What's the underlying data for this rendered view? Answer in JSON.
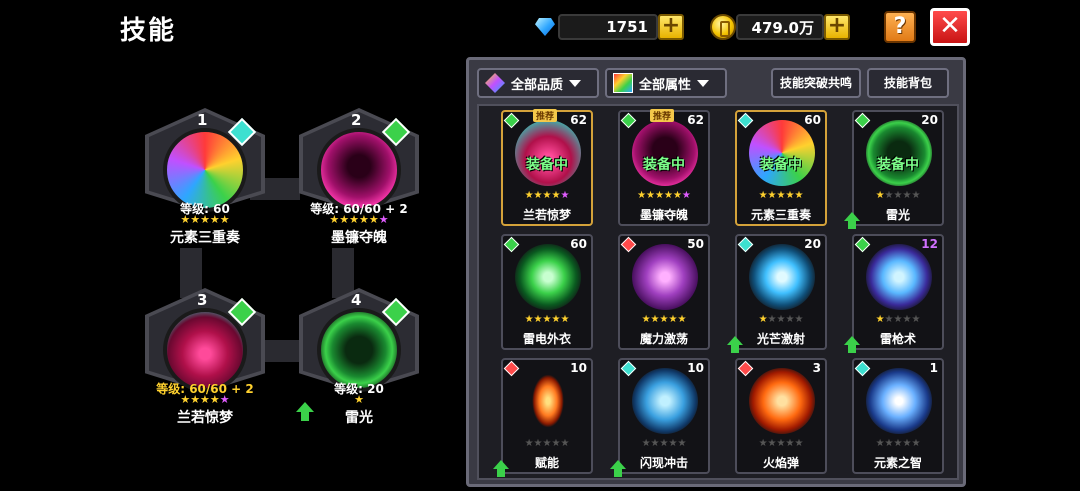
{
  "header": {
    "title": "技能"
  },
  "currency": {
    "gems": "1751",
    "gold": "479.0万",
    "gem_icon": "diamond-icon",
    "gold_icon": "coin-icon",
    "plus": "+"
  },
  "buttons": {
    "help": "?",
    "close": "✕"
  },
  "slots": [
    {
      "num": "1",
      "level": "等级: 60",
      "name": "元素三重奏",
      "stars": "★★★★★",
      "extra_star": ""
    },
    {
      "num": "2",
      "level": "等级: 60/60 + 2",
      "name": "墨镰夺魄",
      "stars": "★★★★★",
      "extra_star": "★"
    },
    {
      "num": "3",
      "level": "等级: 60/60 + 2",
      "name": "兰若惊梦",
      "stars": "★★★★",
      "extra_star": "★"
    },
    {
      "num": "4",
      "level": "等级: 20",
      "name": "雷光",
      "stars": "★",
      "extra_star": ""
    }
  ],
  "filters": {
    "quality": "全部品质",
    "attribute": "全部属性",
    "resonance": "技能突破共鸣",
    "bag": "技能背包"
  },
  "cards": [
    {
      "name": "兰若惊梦",
      "level": "62",
      "recommended": "推荐",
      "equipped": "装备中",
      "stars_on": "★★★★",
      "stars_pink": "★",
      "stars_off": ""
    },
    {
      "name": "墨镰夺魄",
      "level": "62",
      "recommended": "推荐",
      "equipped": "装备中",
      "stars_on": "★★★★★",
      "stars_pink": "★",
      "stars_off": ""
    },
    {
      "name": "元素三重奏",
      "level": "60",
      "recommended": "",
      "equipped": "装备中",
      "stars_on": "★★★★★",
      "stars_pink": "",
      "stars_off": ""
    },
    {
      "name": "雷光",
      "level": "20",
      "recommended": "",
      "equipped": "装备中",
      "stars_on": "★",
      "stars_pink": "",
      "stars_off": "★★★★"
    },
    {
      "name": "雷电外衣",
      "level": "60",
      "recommended": "",
      "equipped": "",
      "stars_on": "★★★★★",
      "stars_pink": "",
      "stars_off": ""
    },
    {
      "name": "魔力激荡",
      "level": "50",
      "recommended": "",
      "equipped": "",
      "stars_on": "★★★★★",
      "stars_pink": "",
      "stars_off": ""
    },
    {
      "name": "光芒激射",
      "level": "20",
      "recommended": "",
      "equipped": "",
      "stars_on": "★",
      "stars_pink": "",
      "stars_off": "★★★★"
    },
    {
      "name": "雷枪术",
      "level": "12",
      "recommended": "",
      "equipped": "",
      "stars_on": "★",
      "stars_pink": "",
      "stars_off": "★★★★"
    },
    {
      "name": "赋能",
      "level": "10",
      "recommended": "",
      "equipped": "",
      "stars_on": "",
      "stars_pink": "",
      "stars_off": "★★★★★"
    },
    {
      "name": "闪现冲击",
      "level": "10",
      "recommended": "",
      "equipped": "",
      "stars_on": "",
      "stars_pink": "",
      "stars_off": "★★★★★"
    },
    {
      "name": "火焰弹",
      "level": "3",
      "recommended": "",
      "equipped": "",
      "stars_on": "",
      "stars_pink": "",
      "stars_off": "★★★★★"
    },
    {
      "name": "元素之智",
      "level": "1",
      "recommended": "",
      "equipped": "",
      "stars_on": "",
      "stars_pink": "",
      "stars_off": "★★★★★"
    }
  ]
}
